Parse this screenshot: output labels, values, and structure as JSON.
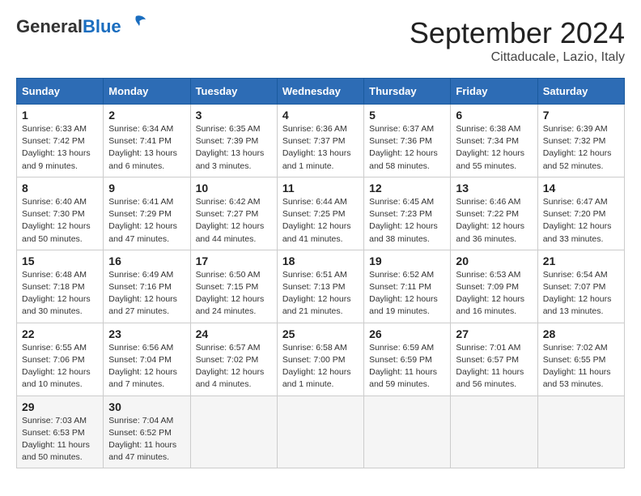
{
  "header": {
    "logo_general": "General",
    "logo_blue": "Blue",
    "month": "September 2024",
    "location": "Cittaducale, Lazio, Italy"
  },
  "days_of_week": [
    "Sunday",
    "Monday",
    "Tuesday",
    "Wednesday",
    "Thursday",
    "Friday",
    "Saturday"
  ],
  "weeks": [
    [
      {
        "day": "1",
        "sunrise": "Sunrise: 6:33 AM",
        "sunset": "Sunset: 7:42 PM",
        "daylight": "Daylight: 13 hours and 9 minutes."
      },
      {
        "day": "2",
        "sunrise": "Sunrise: 6:34 AM",
        "sunset": "Sunset: 7:41 PM",
        "daylight": "Daylight: 13 hours and 6 minutes."
      },
      {
        "day": "3",
        "sunrise": "Sunrise: 6:35 AM",
        "sunset": "Sunset: 7:39 PM",
        "daylight": "Daylight: 13 hours and 3 minutes."
      },
      {
        "day": "4",
        "sunrise": "Sunrise: 6:36 AM",
        "sunset": "Sunset: 7:37 PM",
        "daylight": "Daylight: 13 hours and 1 minute."
      },
      {
        "day": "5",
        "sunrise": "Sunrise: 6:37 AM",
        "sunset": "Sunset: 7:36 PM",
        "daylight": "Daylight: 12 hours and 58 minutes."
      },
      {
        "day": "6",
        "sunrise": "Sunrise: 6:38 AM",
        "sunset": "Sunset: 7:34 PM",
        "daylight": "Daylight: 12 hours and 55 minutes."
      },
      {
        "day": "7",
        "sunrise": "Sunrise: 6:39 AM",
        "sunset": "Sunset: 7:32 PM",
        "daylight": "Daylight: 12 hours and 52 minutes."
      }
    ],
    [
      {
        "day": "8",
        "sunrise": "Sunrise: 6:40 AM",
        "sunset": "Sunset: 7:30 PM",
        "daylight": "Daylight: 12 hours and 50 minutes."
      },
      {
        "day": "9",
        "sunrise": "Sunrise: 6:41 AM",
        "sunset": "Sunset: 7:29 PM",
        "daylight": "Daylight: 12 hours and 47 minutes."
      },
      {
        "day": "10",
        "sunrise": "Sunrise: 6:42 AM",
        "sunset": "Sunset: 7:27 PM",
        "daylight": "Daylight: 12 hours and 44 minutes."
      },
      {
        "day": "11",
        "sunrise": "Sunrise: 6:44 AM",
        "sunset": "Sunset: 7:25 PM",
        "daylight": "Daylight: 12 hours and 41 minutes."
      },
      {
        "day": "12",
        "sunrise": "Sunrise: 6:45 AM",
        "sunset": "Sunset: 7:23 PM",
        "daylight": "Daylight: 12 hours and 38 minutes."
      },
      {
        "day": "13",
        "sunrise": "Sunrise: 6:46 AM",
        "sunset": "Sunset: 7:22 PM",
        "daylight": "Daylight: 12 hours and 36 minutes."
      },
      {
        "day": "14",
        "sunrise": "Sunrise: 6:47 AM",
        "sunset": "Sunset: 7:20 PM",
        "daylight": "Daylight: 12 hours and 33 minutes."
      }
    ],
    [
      {
        "day": "15",
        "sunrise": "Sunrise: 6:48 AM",
        "sunset": "Sunset: 7:18 PM",
        "daylight": "Daylight: 12 hours and 30 minutes."
      },
      {
        "day": "16",
        "sunrise": "Sunrise: 6:49 AM",
        "sunset": "Sunset: 7:16 PM",
        "daylight": "Daylight: 12 hours and 27 minutes."
      },
      {
        "day": "17",
        "sunrise": "Sunrise: 6:50 AM",
        "sunset": "Sunset: 7:15 PM",
        "daylight": "Daylight: 12 hours and 24 minutes."
      },
      {
        "day": "18",
        "sunrise": "Sunrise: 6:51 AM",
        "sunset": "Sunset: 7:13 PM",
        "daylight": "Daylight: 12 hours and 21 minutes."
      },
      {
        "day": "19",
        "sunrise": "Sunrise: 6:52 AM",
        "sunset": "Sunset: 7:11 PM",
        "daylight": "Daylight: 12 hours and 19 minutes."
      },
      {
        "day": "20",
        "sunrise": "Sunrise: 6:53 AM",
        "sunset": "Sunset: 7:09 PM",
        "daylight": "Daylight: 12 hours and 16 minutes."
      },
      {
        "day": "21",
        "sunrise": "Sunrise: 6:54 AM",
        "sunset": "Sunset: 7:07 PM",
        "daylight": "Daylight: 12 hours and 13 minutes."
      }
    ],
    [
      {
        "day": "22",
        "sunrise": "Sunrise: 6:55 AM",
        "sunset": "Sunset: 7:06 PM",
        "daylight": "Daylight: 12 hours and 10 minutes."
      },
      {
        "day": "23",
        "sunrise": "Sunrise: 6:56 AM",
        "sunset": "Sunset: 7:04 PM",
        "daylight": "Daylight: 12 hours and 7 minutes."
      },
      {
        "day": "24",
        "sunrise": "Sunrise: 6:57 AM",
        "sunset": "Sunset: 7:02 PM",
        "daylight": "Daylight: 12 hours and 4 minutes."
      },
      {
        "day": "25",
        "sunrise": "Sunrise: 6:58 AM",
        "sunset": "Sunset: 7:00 PM",
        "daylight": "Daylight: 12 hours and 1 minute."
      },
      {
        "day": "26",
        "sunrise": "Sunrise: 6:59 AM",
        "sunset": "Sunset: 6:59 PM",
        "daylight": "Daylight: 11 hours and 59 minutes."
      },
      {
        "day": "27",
        "sunrise": "Sunrise: 7:01 AM",
        "sunset": "Sunset: 6:57 PM",
        "daylight": "Daylight: 11 hours and 56 minutes."
      },
      {
        "day": "28",
        "sunrise": "Sunrise: 7:02 AM",
        "sunset": "Sunset: 6:55 PM",
        "daylight": "Daylight: 11 hours and 53 minutes."
      }
    ],
    [
      {
        "day": "29",
        "sunrise": "Sunrise: 7:03 AM",
        "sunset": "Sunset: 6:53 PM",
        "daylight": "Daylight: 11 hours and 50 minutes."
      },
      {
        "day": "30",
        "sunrise": "Sunrise: 7:04 AM",
        "sunset": "Sunset: 6:52 PM",
        "daylight": "Daylight: 11 hours and 47 minutes."
      },
      null,
      null,
      null,
      null,
      null
    ]
  ]
}
